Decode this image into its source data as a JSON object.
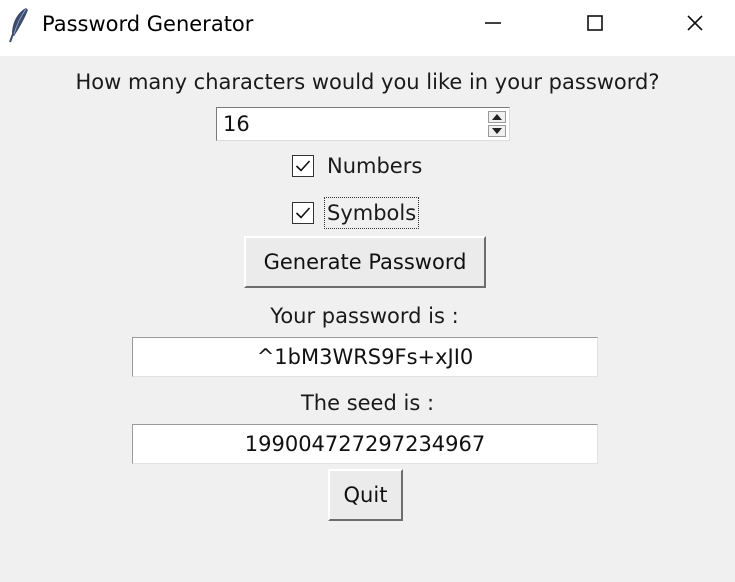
{
  "window": {
    "title": "Password Generator",
    "icon": "feather-icon",
    "controls": {
      "minimize": "minimize-icon",
      "maximize": "maximize-icon",
      "close": "close-icon"
    }
  },
  "form": {
    "length_prompt": "How many characters would you like in your password?",
    "length_value": "16",
    "options": {
      "numbers": {
        "label": "Numbers",
        "checked": true
      },
      "symbols": {
        "label": "Symbols",
        "checked": true
      }
    },
    "generate_label": "Generate Password",
    "password_label": "Your password is :",
    "password_value": "^1bM3WRS9Fs+xJI0",
    "seed_label": "The seed is :",
    "seed_value": "199004727297234967",
    "quit_label": "Quit"
  },
  "colors": {
    "window_bg": "#f0f0f0",
    "titlebar_bg": "#ffffff",
    "feather": "#3c4a6b"
  }
}
